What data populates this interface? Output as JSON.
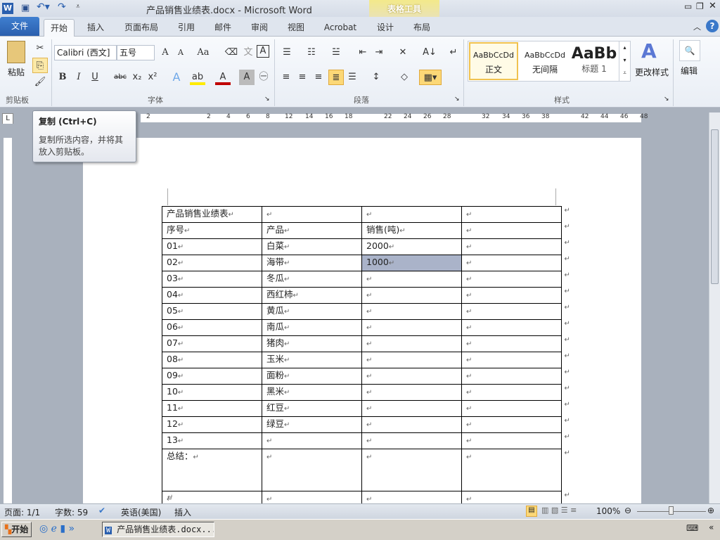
{
  "title": "产品销售业绩表.docx - Microsoft Word",
  "table_tools": "表格工具",
  "tabs": [
    "文件",
    "开始",
    "插入",
    "页面布局",
    "引用",
    "邮件",
    "审阅",
    "视图",
    "Acrobat",
    "设计",
    "布局"
  ],
  "ribbon": {
    "clipboard": {
      "paste": "粘贴",
      "label": "剪贴板"
    },
    "font": {
      "name": "Calibri (西文]",
      "size": "五号",
      "label": "字体"
    },
    "paragraph": {
      "label": "段落"
    },
    "styles": {
      "items": [
        {
          "preview": "AaBbCcDd",
          "name": "正文"
        },
        {
          "preview": "AaBbCcDd",
          "name": "无间隔"
        },
        {
          "preview": "AaBb",
          "name": "标题 1"
        }
      ],
      "change": "更改样式",
      "label": "样式"
    },
    "editing": {
      "label": "编辑"
    }
  },
  "tooltip": {
    "title": "复制 (Ctrl+C)",
    "body": "复制所选内容，并将其放入剪贴板。"
  },
  "ruler_ticks": [
    "2",
    "2",
    "4",
    "6",
    "8",
    "12",
    "14",
    "16",
    "18",
    "22",
    "24",
    "26",
    "28",
    "32",
    "34",
    "36",
    "38",
    "42",
    "44",
    "46",
    "48"
  ],
  "table": {
    "rows": [
      [
        "产品销售业绩表",
        "",
        "",
        ""
      ],
      [
        "序号",
        "产品",
        "销售(吨)",
        ""
      ],
      [
        "01",
        "白菜",
        "2000",
        ""
      ],
      [
        "02",
        "海带",
        "1000",
        ""
      ],
      [
        "03",
        "冬瓜",
        "",
        ""
      ],
      [
        "04",
        "西红柿",
        "",
        ""
      ],
      [
        "05",
        "黄瓜",
        "",
        ""
      ],
      [
        "06",
        "南瓜",
        "",
        ""
      ],
      [
        "07",
        "猪肉",
        "",
        ""
      ],
      [
        "08",
        "玉米",
        "",
        ""
      ],
      [
        "09",
        "面粉",
        "",
        ""
      ],
      [
        "10",
        "黑米",
        "",
        ""
      ],
      [
        "11",
        "红豆",
        "",
        ""
      ],
      [
        "12",
        "绿豆",
        "",
        ""
      ],
      [
        "13",
        "",
        "",
        ""
      ],
      [
        "总结：",
        "",
        "",
        ""
      ],
      [
        "",
        "",
        "",
        ""
      ]
    ]
  },
  "status": {
    "page": "页面: 1/1",
    "words": "字数: 59",
    "lang": "英语(美国)",
    "mode": "插入",
    "zoom": "100%"
  },
  "taskbar": {
    "start": "开始",
    "window": "产品销售业绩表.docx..."
  }
}
